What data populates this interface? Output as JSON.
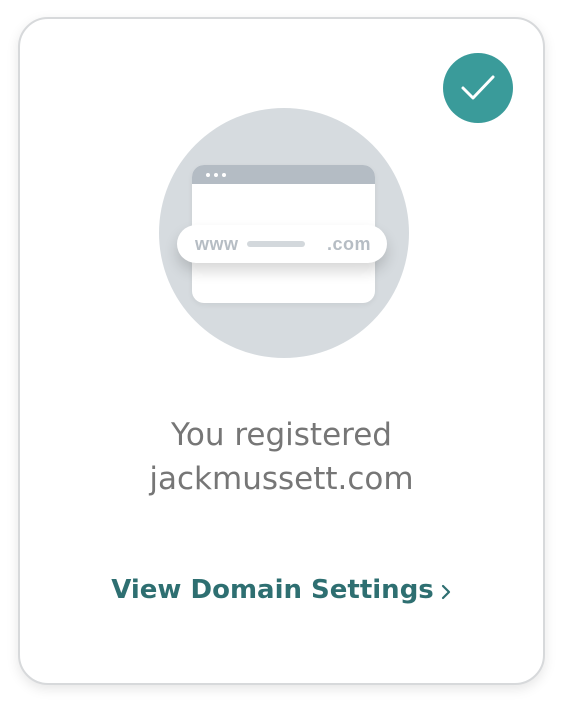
{
  "card": {
    "message_line1": "You registered",
    "domain": "jackmussett.com",
    "link_label": "View Domain Settings"
  },
  "illustration": {
    "url_prefix": "www",
    "url_suffix": ".com"
  },
  "icons": {
    "status": "checkmark-icon",
    "link_arrow": "chevron-right-icon"
  },
  "colors": {
    "accent": "#3a9b9a",
    "link": "#2e6f71",
    "text": "#767676",
    "illustration_bg": "#d6dbdf"
  }
}
